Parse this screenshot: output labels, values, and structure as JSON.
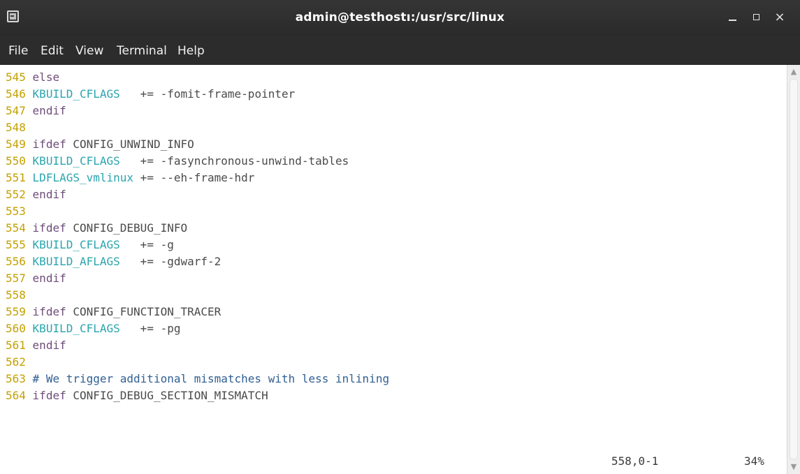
{
  "window": {
    "title": "admin@testhostı:/usr/src/linux",
    "icon": "terminal-icon",
    "buttons": {
      "minimize": "minimize-icon",
      "maximize": "maximize-icon",
      "close": "×"
    }
  },
  "menu": [
    "File",
    "Edit",
    "View",
    "Terminal",
    "Help"
  ],
  "colors": {
    "line_number": "#c4a000",
    "keyword": "#6f4c7a",
    "identifier": "#2aa4ae",
    "comment": "#2f5f93",
    "text": "#4a4a4a",
    "background": "#ffffff",
    "titlebar": "#2c2c2c"
  },
  "editor": {
    "lines": [
      {
        "num": "545",
        "segments": [
          {
            "t": "else",
            "c": "kw"
          }
        ]
      },
      {
        "num": "546",
        "segments": [
          {
            "t": "KBUILD_CFLAGS",
            "c": "id"
          },
          {
            "t": "   += -fomit-frame-pointer",
            "c": "op"
          }
        ]
      },
      {
        "num": "547",
        "segments": [
          {
            "t": "endif",
            "c": "kw"
          }
        ]
      },
      {
        "num": "548",
        "segments": []
      },
      {
        "num": "549",
        "segments": [
          {
            "t": "ifdef",
            "c": "kw"
          },
          {
            "t": " CONFIG_UNWIND_INFO",
            "c": "op"
          }
        ]
      },
      {
        "num": "550",
        "segments": [
          {
            "t": "KBUILD_CFLAGS",
            "c": "id"
          },
          {
            "t": "   += -fasynchronous-unwind-tables",
            "c": "op"
          }
        ]
      },
      {
        "num": "551",
        "segments": [
          {
            "t": "LDFLAGS_vmlinux",
            "c": "id"
          },
          {
            "t": " += --eh-frame-hdr",
            "c": "op"
          }
        ]
      },
      {
        "num": "552",
        "segments": [
          {
            "t": "endif",
            "c": "kw"
          }
        ]
      },
      {
        "num": "553",
        "segments": []
      },
      {
        "num": "554",
        "segments": [
          {
            "t": "ifdef",
            "c": "kw"
          },
          {
            "t": " CONFIG_DEBUG_INFO",
            "c": "op"
          }
        ]
      },
      {
        "num": "555",
        "segments": [
          {
            "t": "KBUILD_CFLAGS",
            "c": "id"
          },
          {
            "t": "   += -g",
            "c": "op"
          }
        ]
      },
      {
        "num": "556",
        "segments": [
          {
            "t": "KBUILD_AFLAGS",
            "c": "id"
          },
          {
            "t": "   += -gdwarf-2",
            "c": "op"
          }
        ]
      },
      {
        "num": "557",
        "segments": [
          {
            "t": "endif",
            "c": "kw"
          }
        ]
      },
      {
        "num": "558",
        "segments": []
      },
      {
        "num": "559",
        "segments": [
          {
            "t": "ifdef",
            "c": "kw"
          },
          {
            "t": " CONFIG_FUNCTION_TRACER",
            "c": "op"
          }
        ]
      },
      {
        "num": "560",
        "segments": [
          {
            "t": "KBUILD_CFLAGS",
            "c": "id"
          },
          {
            "t": "   += -pg",
            "c": "op"
          }
        ]
      },
      {
        "num": "561",
        "segments": [
          {
            "t": "endif",
            "c": "kw"
          }
        ]
      },
      {
        "num": "562",
        "segments": []
      },
      {
        "num": "563",
        "segments": [
          {
            "t": "# We trigger additional mismatches with less inlining",
            "c": "cm"
          }
        ]
      },
      {
        "num": "564",
        "segments": [
          {
            "t": "ifdef",
            "c": "kw"
          },
          {
            "t": " CONFIG_DEBUG_SECTION_MISMATCH",
            "c": "op"
          }
        ]
      }
    ],
    "status": {
      "position": "558,0-1",
      "percent": "34%"
    }
  }
}
